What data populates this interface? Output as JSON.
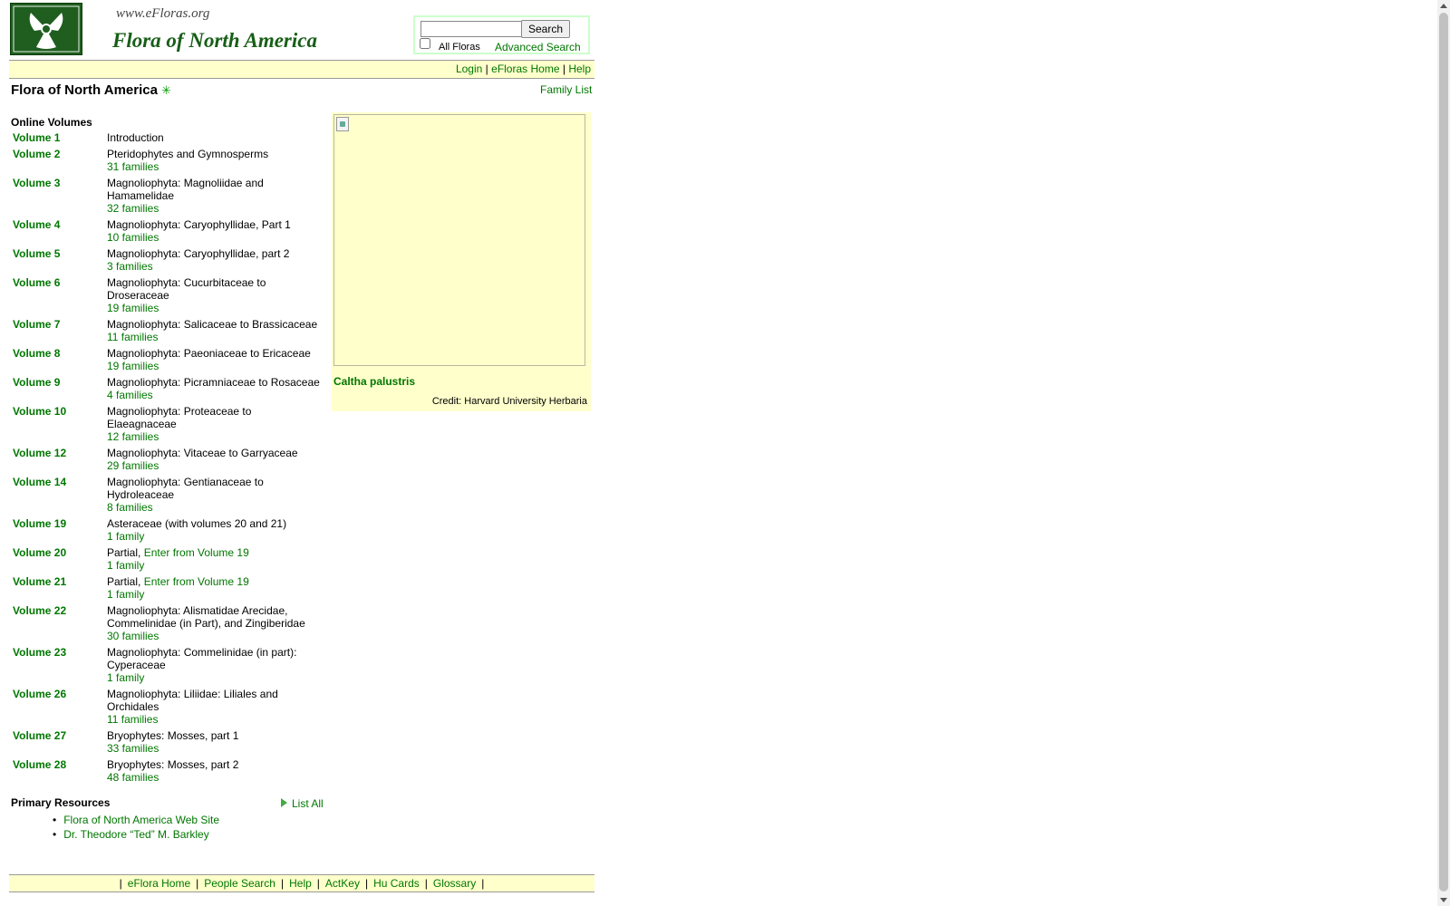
{
  "header": {
    "site_url": "www.eFloras.org",
    "site_title": "Flora of North America",
    "search": {
      "value": "",
      "placeholder": "",
      "button": "Search",
      "all_floras_label": "All Floras",
      "all_floras_checked": false,
      "advanced": "Advanced Search"
    },
    "nav": {
      "login": "Login",
      "sep": "|",
      "home": "eFloras Home",
      "help": "Help"
    }
  },
  "page": {
    "title": "Flora of North America",
    "family_list": "Family List",
    "online_volumes": "Online Volumes",
    "volumes": [
      {
        "name": "Volume 1",
        "desc": "Introduction",
        "families": ""
      },
      {
        "name": "Volume 2",
        "desc": "Pteridophytes and Gymnosperms",
        "families": "31 families"
      },
      {
        "name": "Volume 3",
        "desc": "Magnoliophyta: Magnoliidae and Hamamelidae",
        "families": "32 families"
      },
      {
        "name": "Volume 4",
        "desc": "Magnoliophyta: Caryophyllidae, Part 1",
        "families": "10 families"
      },
      {
        "name": "Volume 5",
        "desc": "Magnoliophyta: Caryophyllidae, part 2",
        "families": "3 families"
      },
      {
        "name": "Volume 6",
        "desc": "Magnoliophyta: Cucurbitaceae to Droseraceae",
        "families": "19 families"
      },
      {
        "name": "Volume 7",
        "desc": "Magnoliophyta: Salicaceae to Brassicaceae",
        "families": "11 families"
      },
      {
        "name": "Volume 8",
        "desc": "Magnoliophyta: Paeoniaceae to Ericaceae",
        "families": "19 families"
      },
      {
        "name": "Volume 9",
        "desc": "Magnoliophyta: Picramniaceae to Rosaceae",
        "families": "4 families"
      },
      {
        "name": "Volume 10",
        "desc": "Magnoliophyta: Proteaceae to Elaeagnaceae",
        "families": "12 families"
      },
      {
        "name": "Volume 12",
        "desc": "Magnoliophyta: Vitaceae to Garryaceae",
        "families": "29 families"
      },
      {
        "name": "Volume 14",
        "desc": "Magnoliophyta: Gentianaceae to Hydroleaceae",
        "families": "8 families"
      },
      {
        "name": "Volume 19",
        "desc": "Asteraceae (with volumes 20 and 21)",
        "families": "1 family"
      },
      {
        "name": "Volume 20",
        "desc": "Partial, ",
        "desc_link": "Enter from Volume 19",
        "families": "1 family"
      },
      {
        "name": "Volume 21",
        "desc": "Partial, ",
        "desc_link": "Enter from Volume 19",
        "families": "1 family"
      },
      {
        "name": "Volume 22",
        "desc": "Magnoliophyta: Alismatidae Arecidae, Commelinidae (in Part), and Zingiberidae",
        "families": "30 families"
      },
      {
        "name": "Volume 23",
        "desc": "Magnoliophyta: Commelinidae (in part): Cyperaceae",
        "families": "1 family"
      },
      {
        "name": "Volume 26",
        "desc": "Magnoliophyta: Liliidae: Liliales and Orchidales",
        "families": "11 families"
      },
      {
        "name": "Volume 27",
        "desc": "Bryophytes: Mosses, part 1",
        "families": "33 families"
      },
      {
        "name": "Volume 28",
        "desc": "Bryophytes: Mosses, part 2",
        "families": "48 families"
      }
    ],
    "image": {
      "caption": "Caltha palustris",
      "credit": "Credit: Harvard University Herbaria"
    },
    "primary_resources": {
      "title": "Primary Resources",
      "list_all": "List All",
      "items": [
        "Flora of North America Web Site",
        "Dr. Theodore “Ted” M. Barkley"
      ]
    }
  },
  "footer": {
    "sep": "|",
    "links": [
      "eFlora Home",
      "People Search",
      "Help",
      "ActKey",
      "Hu Cards",
      "Glossary"
    ]
  },
  "colors": {
    "link": "#007700",
    "band": "#ffffcc",
    "logo": "#1f5e1f"
  }
}
